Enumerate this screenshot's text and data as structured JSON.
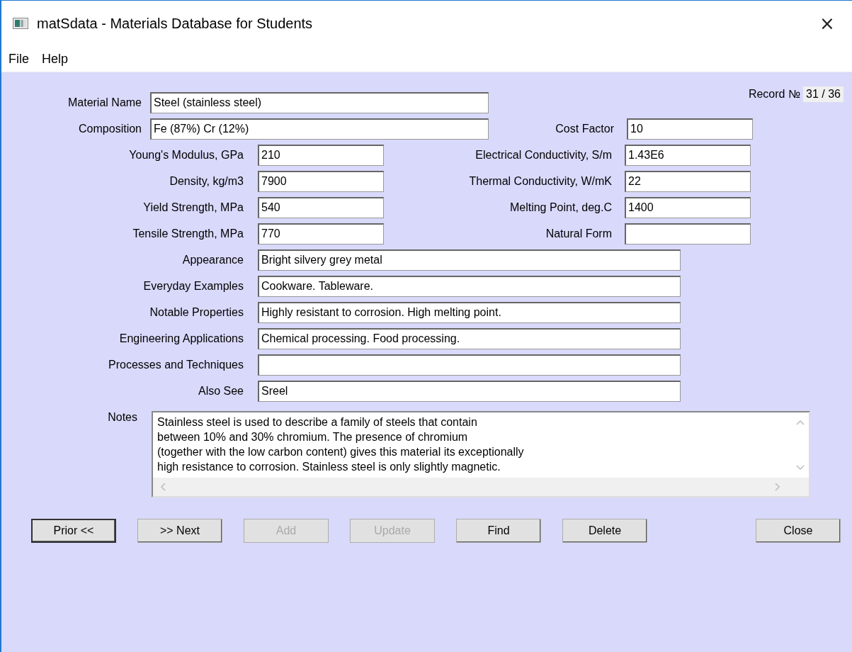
{
  "window": {
    "title": "matSdata - Materials Database for Students",
    "close": "×"
  },
  "menu": [
    "File",
    "Help"
  ],
  "record": {
    "label": "Record №",
    "value": "31 / 36"
  },
  "top_rows": [
    {
      "label": "Material Name",
      "value": "Steel (stainless steel)"
    },
    {
      "label": "Composition",
      "value": "Fe (87%) Cr (12%)",
      "right_label": "Cost Factor",
      "right_value": "10"
    }
  ],
  "pairs": [
    {
      "label": "Young's Modulus, GPa",
      "value": "210",
      "right_label": "Electrical Conductivity, S/m",
      "right_value": "1.43E6"
    },
    {
      "label": "Density, kg/m3",
      "value": "7900",
      "right_label": "Thermal Conductivity, W/mK",
      "right_value": "22"
    },
    {
      "label": "Yield Strength, MPa",
      "value": "540",
      "right_label": "Melting Point, deg.C",
      "right_value": "1400"
    },
    {
      "label": "Tensile Strength, MPa",
      "value": "770",
      "right_label": "Natural Form"
    }
  ],
  "descriptions": [
    {
      "label": "Appearance",
      "value": "Bright silvery grey metal"
    },
    {
      "label": "Everyday Examples",
      "value": "Cookware. Tableware."
    },
    {
      "label": "Notable Properties",
      "value": "Highly resistant to corrosion. High melting point."
    },
    {
      "label": "Engineering Applications",
      "value": "Chemical processing. Food processing."
    },
    {
      "label": "Processes and Techniques"
    },
    {
      "label": "Also See",
      "value": "Sreel"
    }
  ],
  "notes": {
    "label": "Notes",
    "text": "Stainless steel is used to describe a family of steels that contain\nbetween 10% and 30% chromium. The presence of chromium\n(together with the low carbon content) gives this material its exceptionally\nhigh resistance to corrosion. Stainless steel is only slightly magnetic."
  },
  "buttons": [
    {
      "label": "Prior <<",
      "disabled": false,
      "kind": "nav"
    },
    {
      "label": ">> Next",
      "disabled": false,
      "kind": "nav"
    },
    {
      "label": "Add",
      "disabled": true,
      "kind": "nav"
    },
    {
      "label": "Update",
      "disabled": true,
      "kind": "nav"
    },
    {
      "label": "Find",
      "disabled": false,
      "kind": "nav"
    },
    {
      "label": "Delete",
      "disabled": false,
      "kind": "nav"
    },
    {
      "label": "Close",
      "disabled": false,
      "kind": "end"
    }
  ]
}
